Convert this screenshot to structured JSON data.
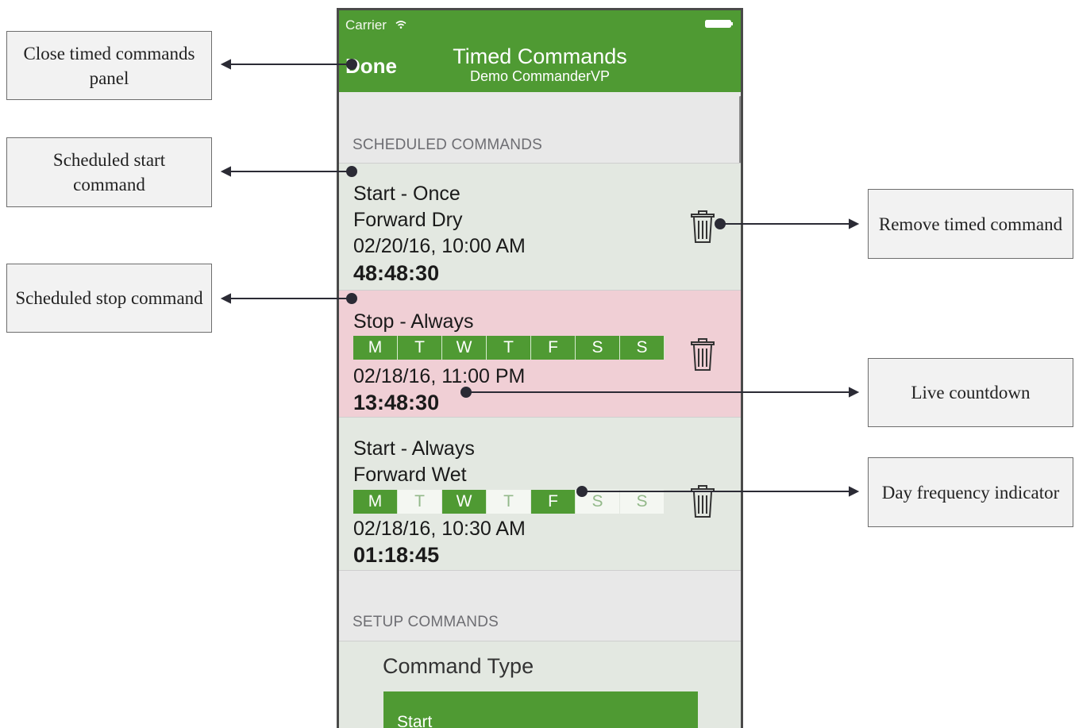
{
  "status_bar": {
    "carrier": "Carrier"
  },
  "navbar": {
    "done_label": "Done",
    "title": "Timed Commands",
    "subtitle": "Demo CommanderVP"
  },
  "sections": {
    "scheduled_header": "SCHEDULED COMMANDS",
    "setup_header": "SETUP COMMANDS"
  },
  "scheduled_commands": [
    {
      "title": "Start - Once",
      "detail": "Forward Dry",
      "datetime": "02/20/16, 10:00 AM",
      "countdown": "48:48:30",
      "highlighted": false,
      "days": null
    },
    {
      "title": "Stop - Always",
      "detail": "",
      "datetime": "02/18/16, 11:00 PM",
      "countdown": "13:48:30",
      "highlighted": true,
      "days": [
        {
          "label": "M",
          "active": true
        },
        {
          "label": "T",
          "active": true
        },
        {
          "label": "W",
          "active": true
        },
        {
          "label": "T",
          "active": true
        },
        {
          "label": "F",
          "active": true
        },
        {
          "label": "S",
          "active": true
        },
        {
          "label": "S",
          "active": true
        }
      ]
    },
    {
      "title": "Start - Always",
      "detail": "Forward Wet",
      "datetime": "02/18/16, 10:30 AM",
      "countdown": "01:18:45",
      "highlighted": false,
      "days": [
        {
          "label": "M",
          "active": true
        },
        {
          "label": "T",
          "active": false
        },
        {
          "label": "W",
          "active": true
        },
        {
          "label": "T",
          "active": false
        },
        {
          "label": "F",
          "active": true
        },
        {
          "label": "S",
          "active": false
        },
        {
          "label": "S",
          "active": false
        }
      ]
    }
  ],
  "setup": {
    "command_type_label": "Command Type",
    "command_type_value": "Start"
  },
  "callouts": {
    "close_panel": "Close timed commands panel",
    "scheduled_start": "Scheduled start command",
    "scheduled_stop": "Scheduled stop command",
    "remove_command": "Remove timed command",
    "live_countdown": "Live countdown",
    "day_frequency": "Day frequency indicator"
  },
  "colors": {
    "accent_green": "#4f9a33",
    "row_background": "#e3e8e1",
    "stop_row_background": "#f0cfd5",
    "inactive_day_text": "#93b98a"
  },
  "icons": [
    "wifi-icon",
    "battery-icon",
    "trash-icon"
  ]
}
